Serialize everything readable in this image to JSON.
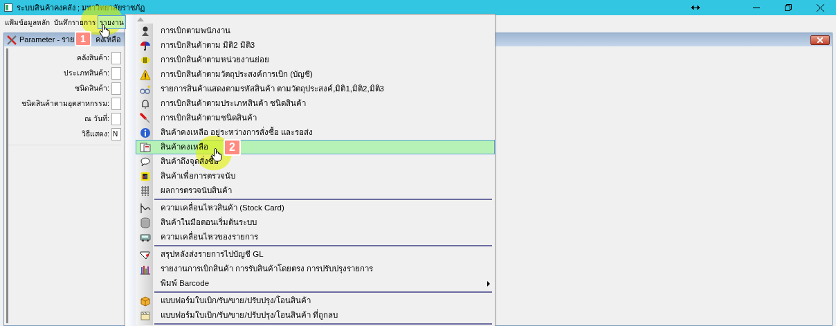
{
  "window": {
    "title": "ระบบสินค้าคงคลัง ; มหาวิทยาลัยราชภัฏ"
  },
  "menu_bar": [
    {
      "label": "แฟ้มข้อมูลหลัก",
      "selected": false
    },
    {
      "label": "บันทึกรายการ",
      "selected": false
    },
    {
      "label": "รายงาน",
      "selected": true
    }
  ],
  "child_window": {
    "title_parts": [
      "Parameter - ราย",
      "คงเหลือ"
    ]
  },
  "form": [
    {
      "label": "คลังสินค้า:"
    },
    {
      "label": "ประเภทสินค้า:"
    },
    {
      "label": "ชนิดสินค้า:"
    },
    {
      "label": "ชนิดสินค้าตามอุตสาหกรรม:"
    },
    {
      "label": "ณ วันที่:"
    },
    {
      "label": "วิธีแสดง:",
      "value": "N"
    }
  ],
  "dropdown_menu": [
    {
      "kind": "item",
      "label": "การเบิกตามพนักงาน",
      "selected": false
    },
    {
      "kind": "item",
      "label": "การเบิกสินค้าตาม มิติ2 มิติ3",
      "selected": false
    },
    {
      "kind": "item",
      "label": "การเบิกสินค้าตามหน่วยงานย่อย",
      "selected": false
    },
    {
      "kind": "item",
      "label": "การเบิกสินค้าตามวัตถุประสงค์การเบิก (บัญชี)",
      "selected": false
    },
    {
      "kind": "item",
      "label": "รายการสินค้าแสดงตามรหัสสินค้า  ตามวัตถุประสงค์,มิติ1,มิติ2,มิติ3",
      "selected": false
    },
    {
      "kind": "item",
      "label": "การเบิกสินค้าตามประเภทสินค้า ชนิดสินค้า",
      "selected": false
    },
    {
      "kind": "item",
      "label": "การเบิกสินค้าตามชนิดสินค้า",
      "selected": false
    },
    {
      "kind": "item",
      "label": "สินค้าคงเหลือ อยู่ระหว่างการสั่งซื้อ และรอส่ง",
      "selected": false
    },
    {
      "kind": "item",
      "label": "สินค้าคงเหลือ",
      "selected": true
    },
    {
      "kind": "item",
      "label": "สินค้าถึงจุดสั่งซื้อ",
      "selected": false
    },
    {
      "kind": "item",
      "label": "สินค้าเพื่อการตรวจนับ",
      "selected": false
    },
    {
      "kind": "item",
      "label": "ผลการตรวจนับสินค้า",
      "selected": false
    },
    {
      "kind": "separator"
    },
    {
      "kind": "item",
      "label": "ความเคลื่อนไหวสินค้า  (Stock Card)",
      "selected": false
    },
    {
      "kind": "item",
      "label": "สินค้าในมือตอนเริ่มต้นระบบ",
      "selected": false
    },
    {
      "kind": "item",
      "label": "ความเคลื่อนไหวของรายการ",
      "selected": false
    },
    {
      "kind": "separator"
    },
    {
      "kind": "item",
      "label": "สรุปหลังส่งรายการไปบัญชี GL",
      "selected": false
    },
    {
      "kind": "item",
      "label": "รายงานการเบิกสินค้า การรับสินค้าโดยตรง การปรับปรุงรายการ",
      "selected": false
    },
    {
      "kind": "submenu",
      "label": "พิมพ์ Barcode",
      "selected": false
    },
    {
      "kind": "separator"
    },
    {
      "kind": "item",
      "label": "แบบฟอร์มใบเบิก/รับ/ขาย/ปรับปรุง/โอนสินค้า",
      "selected": false
    },
    {
      "kind": "item",
      "label": "แบบฟอร์มใบเบิก/รับ/ขาย/ปรับปรุง/โอนสินค้า ที่ถูกลบ",
      "selected": false
    },
    {
      "kind": "separator"
    }
  ],
  "step_badges": [
    "1",
    "2"
  ]
}
